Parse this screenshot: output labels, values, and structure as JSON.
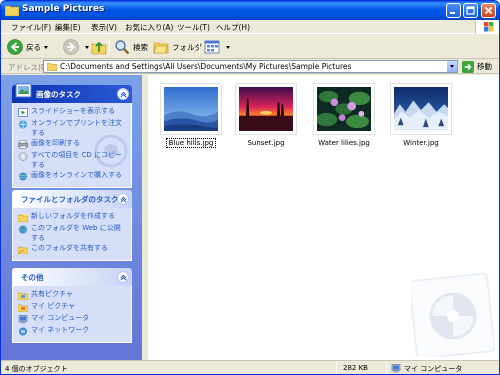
{
  "window": {
    "title": "Sample Pictures"
  },
  "menu": [
    "ファイル(F)",
    "編集(E)",
    "表示(V)",
    "お気に入り(A)",
    "ツール(T)",
    "ヘルプ(H)"
  ],
  "toolbar": {
    "back_label": "戻る",
    "search_label": "検索",
    "folders_label": "フォルダ"
  },
  "address": {
    "label": "アドレス(D)",
    "path": "C:\\Documents and Settings\\All Users\\Documents\\My Pictures\\Sample Pictures",
    "go_label": "移動"
  },
  "taskpane": {
    "picture_tasks": {
      "title": "画像のタスク",
      "items": [
        "スライドショーを表示する",
        "オンラインでプリントを注文する",
        "画像を印刷する",
        "すべての項目を CD にコピーする",
        "画像をオンラインで購入する"
      ]
    },
    "file_tasks": {
      "title": "ファイルとフォルダのタスク",
      "items": [
        "新しいフォルダを作成する",
        "このフォルダを Web に公開する",
        "このフォルダを共有する"
      ]
    },
    "other": {
      "title": "その他",
      "items": [
        "共有ピクチャ",
        "マイ ピクチャ",
        "マイ コンピュータ",
        "マイ ネットワーク"
      ]
    }
  },
  "files": [
    {
      "name": "Blue hills.jpg",
      "selected": true
    },
    {
      "name": "Sunset.jpg",
      "selected": false
    },
    {
      "name": "Water lilies.jpg",
      "selected": false
    },
    {
      "name": "Winter.jpg",
      "selected": false
    }
  ],
  "status": {
    "objects": "4 個のオブジェクト",
    "size": "282 KB",
    "location": "マイ コンピュータ"
  }
}
